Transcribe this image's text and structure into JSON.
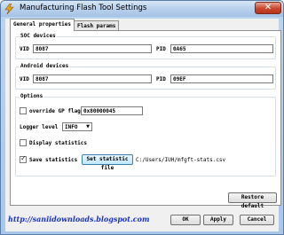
{
  "window": {
    "title": "Manufacturing Flash Tool Settings",
    "close_label": "✕"
  },
  "tabs": [
    {
      "label": "General properties",
      "active": true
    },
    {
      "label": "Flash params",
      "active": false
    }
  ],
  "soc_devices": {
    "title": "SOC devices",
    "vid_label": "VID",
    "vid_value": "8087",
    "pid_label": "PID",
    "pid_value": "0A65"
  },
  "android_devices": {
    "title": "Android devices",
    "vid_label": "VID",
    "vid_value": "8087",
    "pid_label": "PID",
    "pid_value": "09EF"
  },
  "options": {
    "title": "Options",
    "override_gp_label": "override GP flag",
    "override_gp_checked": false,
    "override_gp_value": "0x80000045",
    "logger_level_label": "Logger level",
    "logger_level_value": "INFO",
    "display_statistics_label": "Display statistics",
    "display_statistics_checked": false,
    "save_statistics_label": "Save statistics",
    "save_statistics_checked": true,
    "set_statistic_file_label": "Set statistic file",
    "statistic_file_path": "C:/Users/IUH/mfgft-stats.csv"
  },
  "buttons": {
    "restore_default": "Restore default",
    "ok": "OK",
    "apply": "Apply",
    "cancel": "Cancel"
  },
  "watermark": "http://saniidownloads.blogspot.com"
}
